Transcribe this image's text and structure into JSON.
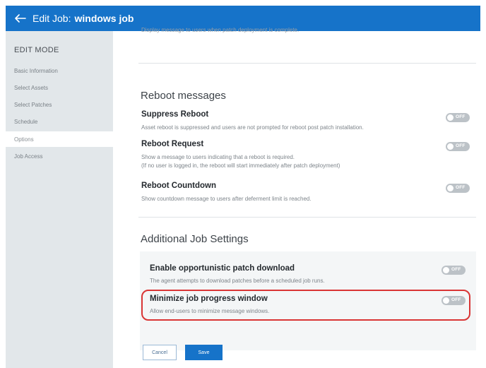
{
  "header": {
    "title_prefix": "Edit Job:",
    "job_name": "windows job"
  },
  "sidebar": {
    "mode_label": "EDIT MODE",
    "items": [
      {
        "label": "Basic Information"
      },
      {
        "label": "Select Assets"
      },
      {
        "label": "Select Patches"
      },
      {
        "label": "Schedule"
      },
      {
        "label": "Options"
      },
      {
        "label": "Job Access"
      }
    ],
    "active_item": "Options"
  },
  "main": {
    "cut_off_text": "Display message to users when patch deployment is complete.",
    "reboot_section": {
      "title": "Reboot messages",
      "settings": [
        {
          "title": "Suppress Reboot",
          "desc": "Asset reboot is suppressed and users are not prompted for reboot post patch installation.",
          "toggle": "OFF"
        },
        {
          "title": "Reboot Request",
          "desc": "Show a message to users indicating that a reboot is required.",
          "desc2": "(If no user is logged in, the reboot will start immediately after patch deployment)",
          "toggle": "OFF"
        },
        {
          "title": "Reboot Countdown",
          "desc": "Show countdown message to users after deferment limit is reached.",
          "toggle": "OFF"
        }
      ]
    },
    "additional_section": {
      "title": "Additional Job Settings",
      "settings": [
        {
          "title": "Enable opportunistic patch download",
          "desc": "The agent attempts to download patches before a scheduled job runs.",
          "toggle": "OFF"
        },
        {
          "title": "Minimize job progress window",
          "desc": "Allow end-users to minimize message windows.",
          "toggle": "OFF"
        }
      ]
    },
    "buttons": {
      "cancel": "Cancel",
      "save": "Save"
    }
  },
  "colors": {
    "header_bg": "#1673c9",
    "sidebar_bg": "#e2e7ea",
    "toggle_off": "#bcc2c7",
    "highlight": "#d93535"
  }
}
